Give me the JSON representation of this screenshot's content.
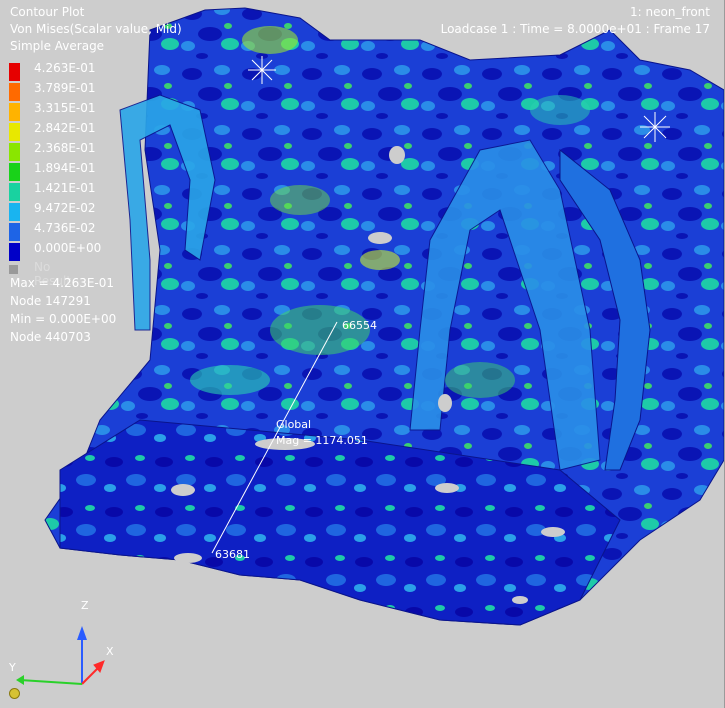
{
  "header": {
    "plot_type": "Contour Plot",
    "result_type": "Von Mises(Scalar value, Mid)",
    "averaging": "Simple Average",
    "model_name": "1: neon_front",
    "loadcase": "Loadcase 1 : Time = 8.0000e+01 : Frame 17"
  },
  "legend": {
    "entries": [
      {
        "label": "4.263E-01",
        "color": "#e60000"
      },
      {
        "label": "3.789E-01",
        "color": "#ff6a00"
      },
      {
        "label": "3.315E-01",
        "color": "#ffb300"
      },
      {
        "label": "2.842E-01",
        "color": "#e8e800"
      },
      {
        "label": "2.368E-01",
        "color": "#8ae600"
      },
      {
        "label": "1.894E-01",
        "color": "#19d219"
      },
      {
        "label": "1.421E-01",
        "color": "#19d2a0"
      },
      {
        "label": "9.472E-02",
        "color": "#19b4f0"
      },
      {
        "label": "4.736E-02",
        "color": "#1e64e6"
      },
      {
        "label": "0.000E+00",
        "color": "#0000c8"
      }
    ],
    "no_result_label": "No Result"
  },
  "minmax": {
    "max_label": "Max = 4.263E-01",
    "max_node": "Node 147291",
    "min_label": "Min = 0.000E+00",
    "min_node": "Node 440703"
  },
  "measure": {
    "node_a": "66554",
    "node_b": "63681",
    "system": "Global",
    "magnitude": "Mag = 1174.051"
  },
  "triad": {
    "z_label": "Z",
    "x_label": "X",
    "y_label": "Y",
    "z_color": "#2a5cff",
    "x_color": "#ff2a2a",
    "y_color": "#2ad12a"
  }
}
